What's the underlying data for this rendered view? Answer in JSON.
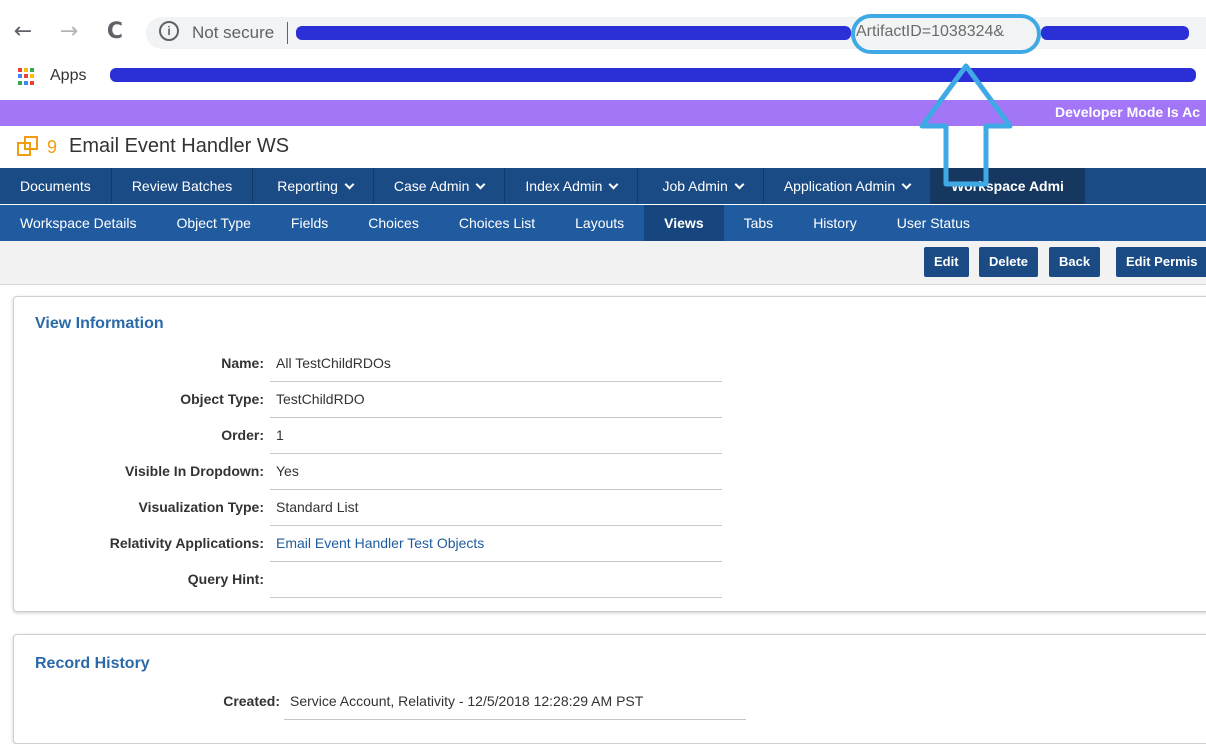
{
  "browser": {
    "nav": {
      "back": "←",
      "forward": "→",
      "reload": "C"
    },
    "security_label": "Not secure",
    "url_visible": "ArtifactID=1038324&",
    "bookmarks": {
      "apps_label": "Apps"
    }
  },
  "banner": {
    "text": "Developer Mode Is Ac"
  },
  "workspace": {
    "number": "9",
    "name": "Email Event Handler WS"
  },
  "main_nav": [
    {
      "label": "Documents",
      "dropdown": false
    },
    {
      "label": "Review Batches",
      "dropdown": false
    },
    {
      "label": "Reporting",
      "dropdown": true
    },
    {
      "label": "Case Admin",
      "dropdown": true
    },
    {
      "label": "Index Admin",
      "dropdown": true
    },
    {
      "label": "Job Admin",
      "dropdown": true
    },
    {
      "label": "Application Admin",
      "dropdown": true
    },
    {
      "label": "Workspace Admi",
      "dropdown": false,
      "active": true
    }
  ],
  "sub_nav": [
    {
      "label": "Workspace Details"
    },
    {
      "label": "Object Type"
    },
    {
      "label": "Fields"
    },
    {
      "label": "Choices"
    },
    {
      "label": "Choices List"
    },
    {
      "label": "Layouts"
    },
    {
      "label": "Views",
      "active": true
    },
    {
      "label": "Tabs"
    },
    {
      "label": "History"
    },
    {
      "label": "User Status"
    }
  ],
  "toolbar": {
    "edit": "Edit",
    "delete": "Delete",
    "back": "Back",
    "edit_permissions": "Edit Permis"
  },
  "view_info": {
    "title": "View Information",
    "fields": [
      {
        "label": "Name:",
        "value": "All TestChildRDOs",
        "link": false
      },
      {
        "label": "Object Type:",
        "value": "TestChildRDO",
        "link": false
      },
      {
        "label": "Order:",
        "value": "1",
        "link": false
      },
      {
        "label": "Visible In Dropdown:",
        "value": "Yes",
        "link": false
      },
      {
        "label": "Visualization Type:",
        "value": "Standard List",
        "link": false
      },
      {
        "label": "Relativity Applications:",
        "value": "Email Event Handler Test Objects",
        "link": true
      },
      {
        "label": "Query Hint:",
        "value": "",
        "link": false
      }
    ]
  },
  "record_history": {
    "title": "Record History",
    "created_label": "Created:",
    "created_value": "Service Account, Relativity - 12/5/2018 12:28:29 AM PST"
  },
  "colors": {
    "main_nav_bg": "#1a4b85",
    "sub_nav_bg": "#205ba0",
    "banner_bg": "#a376f7",
    "annotation": "#3fa9e5",
    "redaction": "#2b2fd6"
  }
}
